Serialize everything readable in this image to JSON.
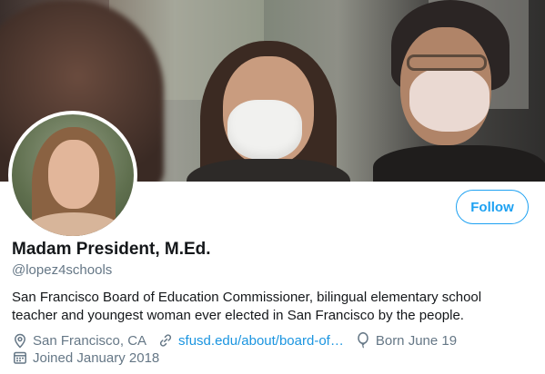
{
  "profile": {
    "display_name": "Madam President, M.Ed.",
    "handle": "@lopez4schools",
    "bio": "San Francisco Board of Education Commissioner, bilingual elementary school teacher and youngest woman ever elected in San Francisco by the people.",
    "location": "San Francisco, CA",
    "website": "sfusd.edu/about/board-of…",
    "birthday": "Born June 19",
    "joined": "Joined January 2018"
  },
  "actions": {
    "follow_label": "Follow"
  },
  "icons": {
    "location": "location-pin-icon",
    "website": "link-icon",
    "birthday": "balloon-icon",
    "joined": "calendar-icon"
  },
  "colors": {
    "accent": "#1da1f2",
    "link": "#1b95e0",
    "secondary_text": "#657786",
    "primary_text": "#14171a"
  }
}
